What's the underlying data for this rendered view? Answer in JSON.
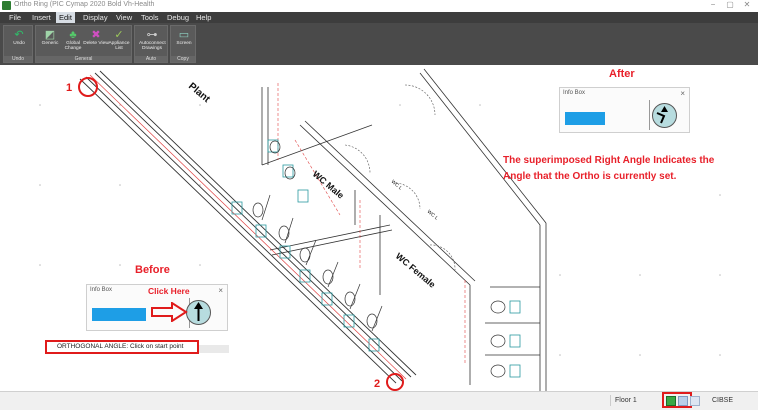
{
  "window": {
    "title": "Ortho Ring (PIC Cymap 2020 Bold Vh-Health",
    "controls": [
      "−",
      "▢",
      "✕"
    ]
  },
  "menu": [
    "File",
    "Insert",
    "Edit",
    "Display",
    "View",
    "Tools",
    "Debug",
    "Help"
  ],
  "ribbon": {
    "groups": [
      {
        "name": "Undo",
        "buttons": [
          {
            "label": "Undo",
            "icon": "undo-icon"
          }
        ]
      },
      {
        "name": "General",
        "buttons": [
          {
            "label": "Generic",
            "icon": "generic-icon"
          },
          {
            "label": "Global Change",
            "icon": "global-change-icon"
          },
          {
            "label": "Delete View",
            "icon": "delete-view-icon"
          },
          {
            "label": "Appliance List",
            "icon": "appliance-list-icon"
          }
        ]
      },
      {
        "name": "Auto",
        "buttons": [
          {
            "label": "Autoconnect Drawings",
            "icon": "autoconnect-icon"
          }
        ]
      },
      {
        "name": "Copy",
        "buttons": [
          {
            "label": "Screen",
            "icon": "screen-icon"
          }
        ]
      }
    ]
  },
  "drawing": {
    "room_labels": [
      "Plant",
      "WC Male",
      "WC Female"
    ],
    "fitting_labels": [
      "WC L",
      "WC L"
    ],
    "markers": [
      "1",
      "2"
    ]
  },
  "annotations": {
    "after_heading": "After",
    "before_heading": "Before",
    "click_here": "Click Here",
    "note_line1": "The superimposed Right Angle Indicates the",
    "note_line2": "Angle that the Ortho is currently set."
  },
  "info_box_after": {
    "title": "Info Box",
    "close": "×"
  },
  "info_box_before": {
    "title": "Info Box",
    "close": "×"
  },
  "command_line": "ORTHOGONAL ANGLE: Click on start point",
  "status": {
    "floor": "Floor 1",
    "standard": "CIBSE"
  },
  "colors": {
    "accent": "#1e9ee6",
    "annotation_red": "#e8202a",
    "menubar": "#3d3d3d",
    "ribbon": "#4a4a4a"
  }
}
